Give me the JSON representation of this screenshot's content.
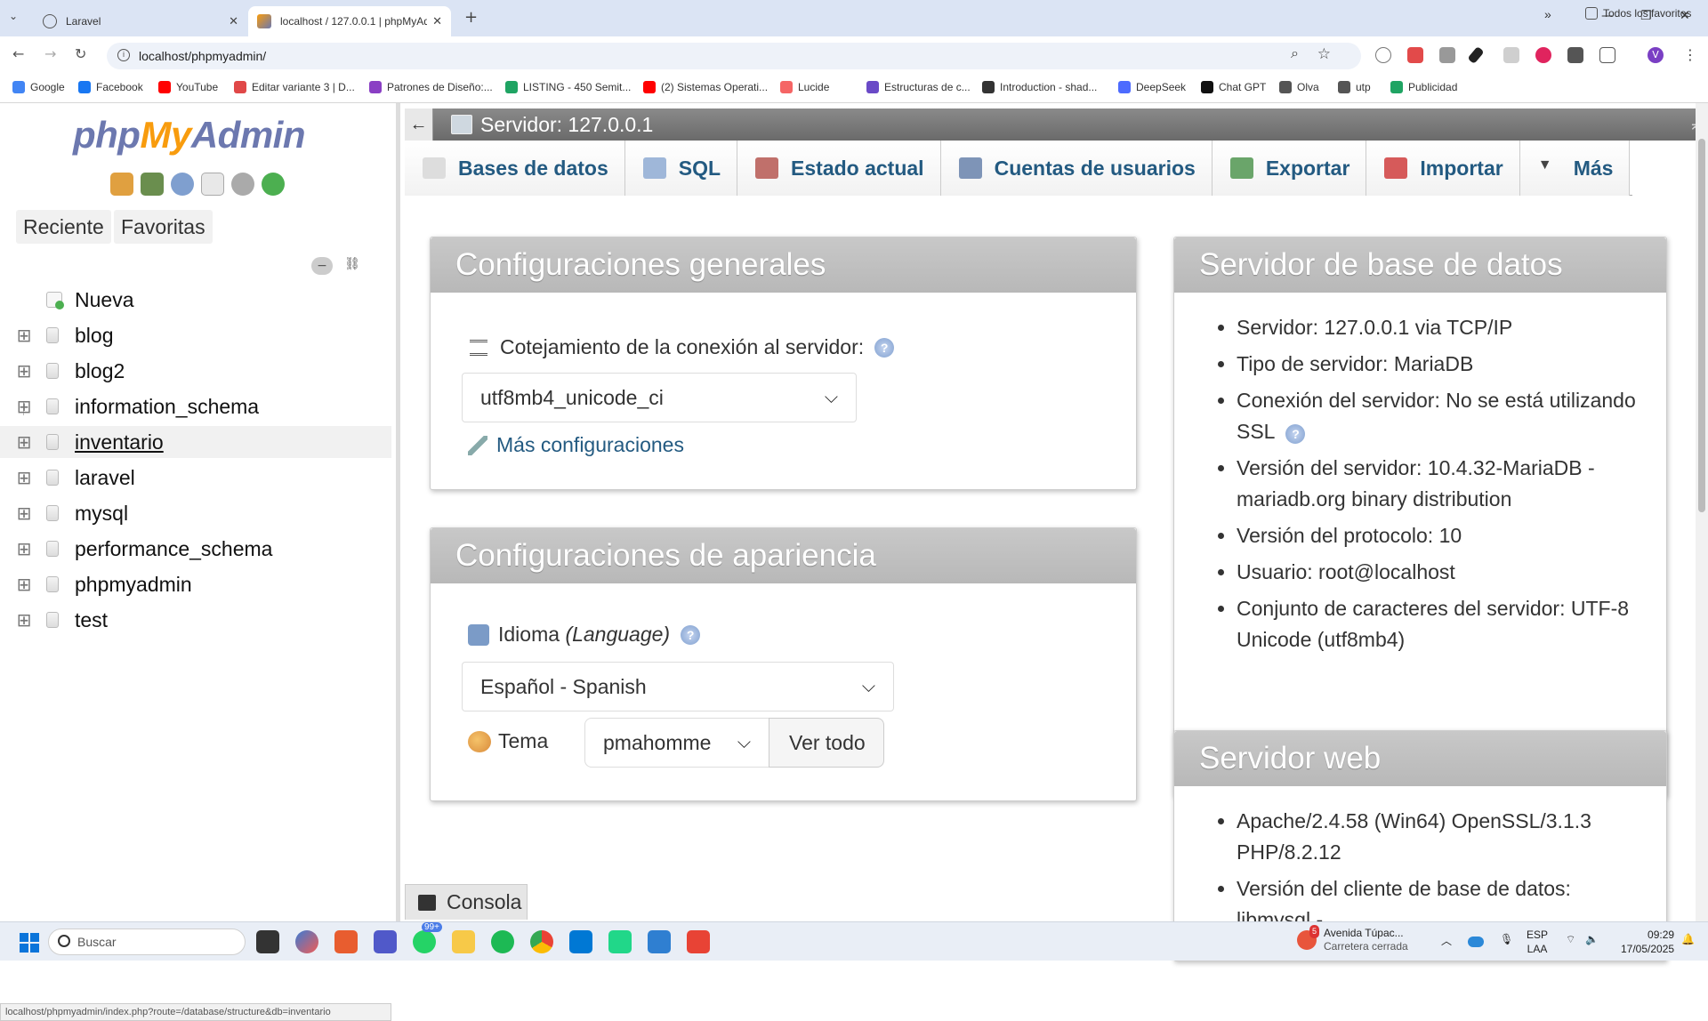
{
  "browser": {
    "tabs": [
      {
        "title": "Laravel"
      },
      {
        "title": "localhost / 127.0.0.1 | phpMyAd"
      }
    ],
    "url": "localhost/phpmyadmin/",
    "bookmarks": [
      {
        "label": "Google",
        "color": "#4285f4"
      },
      {
        "label": "Facebook",
        "color": "#1877f2"
      },
      {
        "label": "YouTube",
        "color": "#ff0000"
      },
      {
        "label": "Editar variante 3 | D...",
        "color": "#e04848"
      },
      {
        "label": "Patrones de Diseño:...",
        "color": "#8a3fc4"
      },
      {
        "label": "LISTING - 450 Semit...",
        "color": "#1fa463"
      },
      {
        "label": "(2) Sistemas Operati...",
        "color": "#ff0000"
      },
      {
        "label": "Lucide",
        "color": "#f56565"
      },
      {
        "label": "Estructuras de c...",
        "color": "#6a4ac7"
      },
      {
        "label": "Introduction - shad...",
        "color": "#333333"
      },
      {
        "label": "DeepSeek",
        "color": "#4d6bfe"
      },
      {
        "label": "Chat GPT",
        "color": "#111111"
      },
      {
        "label": "Olva",
        "color": "#555555"
      },
      {
        "label": "utp",
        "color": "#555555"
      },
      {
        "label": "Publicidad",
        "color": "#1fa463"
      }
    ],
    "all_bookmarks": "Todos los favoritos",
    "status_url": "localhost/phpmyadmin/index.php?route=/database/structure&db=inventario"
  },
  "sidebar": {
    "logo_php": "php",
    "logo_my": "My",
    "logo_admin": "Admin",
    "recent": "Reciente",
    "favorites": "Favoritas",
    "new_label": "Nueva",
    "databases": [
      "blog",
      "blog2",
      "information_schema",
      "inventario",
      "laravel",
      "mysql",
      "performance_schema",
      "phpmyadmin",
      "test"
    ],
    "hovered_database": "inventario"
  },
  "header": {
    "server_title": "Servidor: 127.0.0.1"
  },
  "menu": [
    {
      "label": "Bases de datos",
      "icon": "database-icon"
    },
    {
      "label": "SQL",
      "icon": "sql-icon"
    },
    {
      "label": "Estado actual",
      "icon": "status-icon"
    },
    {
      "label": "Cuentas de usuarios",
      "icon": "users-icon"
    },
    {
      "label": "Exportar",
      "icon": "export-icon"
    },
    {
      "label": "Importar",
      "icon": "import-icon"
    },
    {
      "label": "Más",
      "icon": "chevron-down-icon"
    }
  ],
  "general_settings": {
    "title": "Configuraciones generales",
    "collation_label": "Cotejamiento de la conexión al servidor:",
    "collation_value": "utf8mb4_unicode_ci",
    "more_settings": "Más configuraciones"
  },
  "appearance_settings": {
    "title": "Configuraciones de apariencia",
    "language_label": "Idioma",
    "language_label_en": "(Language)",
    "language_value": "Español - Spanish",
    "theme_label": "Tema",
    "theme_value": "pmahomme",
    "view_all": "Ver todo"
  },
  "db_server": {
    "title": "Servidor de base de datos",
    "items": [
      "Servidor: 127.0.0.1 via TCP/IP",
      "Tipo de servidor: MariaDB",
      "Conexión del servidor: No se está utilizando SSL",
      "Versión del servidor: 10.4.32-MariaDB - mariadb.org binary distribution",
      "Versión del protocolo: 10",
      "Usuario: root@localhost",
      "Conjunto de caracteres del servidor: UTF-8 Unicode (utf8mb4)"
    ]
  },
  "web_server": {
    "title": "Servidor web",
    "items": [
      "Apache/2.4.58 (Win64) OpenSSL/3.1.3 PHP/8.2.12",
      "Versión del cliente de base de datos: libmysql -"
    ]
  },
  "console": {
    "label": "Consola"
  },
  "taskbar": {
    "search": "Buscar",
    "weather_line1": "Avenida Túpac...",
    "weather_line2": "Carretera cerrada",
    "lang1": "ESP",
    "lang2": "LAA",
    "time": "09:29",
    "date": "17/05/2025",
    "whatsapp_badge": "99+",
    "weather_badge": "5"
  }
}
